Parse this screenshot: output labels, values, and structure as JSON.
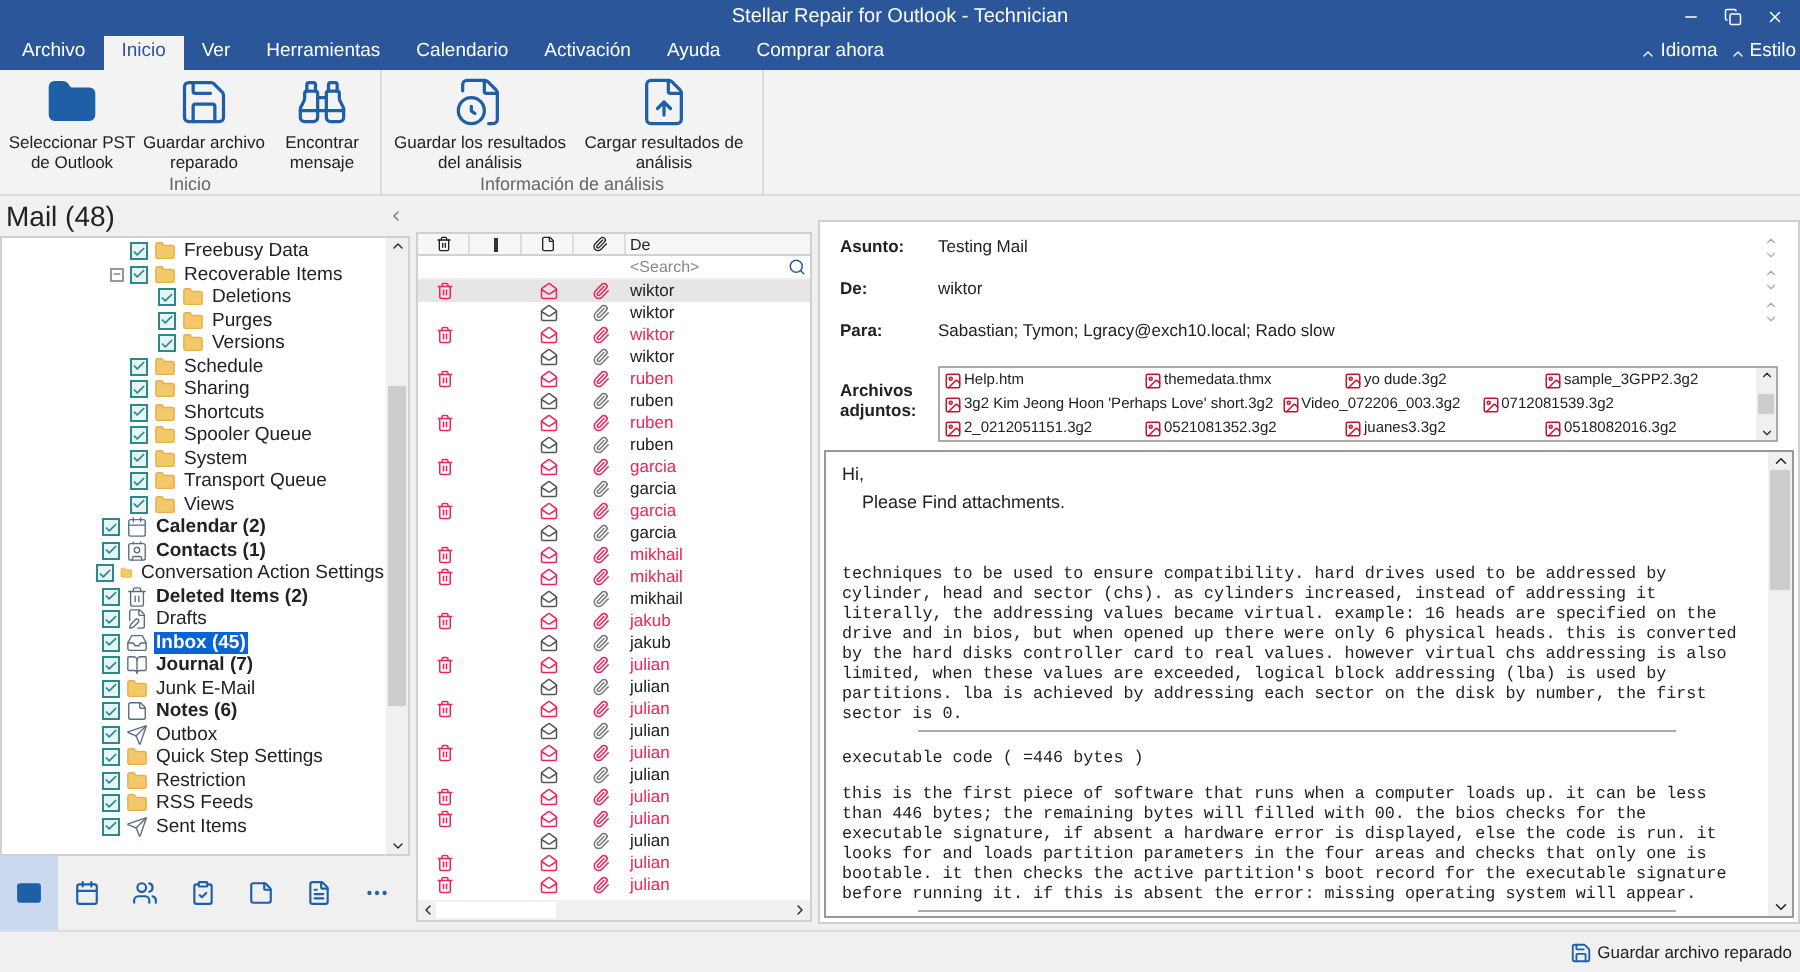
{
  "window": {
    "title": "Stellar Repair for Outlook - Technician"
  },
  "tabs": [
    {
      "label": "Archivo",
      "selected": false
    },
    {
      "label": "Inicio",
      "selected": true
    },
    {
      "label": "Ver",
      "selected": false
    },
    {
      "label": "Herramientas",
      "selected": false
    },
    {
      "label": "Calendario",
      "selected": false
    },
    {
      "label": "Activación",
      "selected": false
    },
    {
      "label": "Ayuda",
      "selected": false
    },
    {
      "label": "Comprar ahora",
      "selected": false
    }
  ],
  "menu_right": [
    "Idioma",
    "Estilo"
  ],
  "ribbon_groups": [
    {
      "label": "Inicio",
      "buttons": [
        {
          "kind": "folder",
          "label": "Seleccionar PST de Outlook"
        },
        {
          "kind": "save",
          "label": "Guardar archivo reparado"
        },
        {
          "kind": "find",
          "label": "Encontrar mensaje"
        }
      ]
    },
    {
      "label": "Información de análisis",
      "buttons": [
        {
          "kind": "save-scan",
          "label": "Guardar los resultados del análisis"
        },
        {
          "kind": "load-scan",
          "label": "Cargar resultados de análisis"
        }
      ]
    }
  ],
  "sidebar": {
    "title": "Mail (48)",
    "tree": [
      {
        "children": [
          {
            "label": "Freebusy Data",
            "kind": "folder",
            "checked": true,
            "unread": false,
            "selected": false
          },
          {
            "label": "Recoverable Items",
            "kind": "folder",
            "checked": true,
            "unread": false,
            "selected": false,
            "expanded": true,
            "children": [
              {
                "label": "Deletions",
                "kind": "folder",
                "checked": true,
                "unread": false,
                "selected": false
              },
              {
                "label": "Purges",
                "kind": "folder",
                "checked": true,
                "unread": false,
                "selected": false
              },
              {
                "label": "Versions",
                "kind": "folder",
                "checked": true,
                "unread": false,
                "selected": false
              }
            ]
          },
          {
            "label": "Schedule",
            "kind": "folder",
            "checked": true,
            "unread": false,
            "selected": false
          },
          {
            "label": "Sharing",
            "kind": "folder",
            "checked": true,
            "unread": false,
            "selected": false
          },
          {
            "label": "Shortcuts",
            "kind": "folder",
            "checked": true,
            "unread": false,
            "selected": false
          },
          {
            "label": "Spooler Queue",
            "kind": "folder",
            "checked": true,
            "unread": false,
            "selected": false
          },
          {
            "label": "System",
            "kind": "folder",
            "checked": true,
            "unread": false,
            "selected": false
          },
          {
            "label": "Transport Queue",
            "kind": "folder",
            "checked": true,
            "unread": false,
            "selected": false
          },
          {
            "label": "Views",
            "kind": "folder",
            "checked": true,
            "unread": false,
            "selected": false
          }
        ]
      },
      {
        "label": "Calendar (2)",
        "kind": "calendar",
        "checked": true,
        "unread": true,
        "selected": false
      },
      {
        "label": "Contacts (1)",
        "kind": "contacts",
        "checked": true,
        "unread": true,
        "selected": false
      },
      {
        "label": "Conversation Action Settings",
        "kind": "folder",
        "checked": true,
        "unread": false,
        "selected": false
      },
      {
        "label": "Deleted Items (2)",
        "kind": "trash",
        "checked": true,
        "unread": true,
        "selected": false
      },
      {
        "label": "Drafts",
        "kind": "drafts",
        "checked": true,
        "unread": false,
        "selected": false
      },
      {
        "label": "Inbox (45)",
        "kind": "inbox",
        "checked": true,
        "unread": true,
        "selected": true
      },
      {
        "label": "Journal (7)",
        "kind": "journal",
        "checked": true,
        "unread": true,
        "selected": false
      },
      {
        "label": "Junk E-Mail",
        "kind": "folder",
        "checked": true,
        "unread": false,
        "selected": false
      },
      {
        "label": "Notes (6)",
        "kind": "notes",
        "checked": true,
        "unread": true,
        "selected": false
      },
      {
        "label": "Outbox",
        "kind": "outbox",
        "checked": true,
        "unread": false,
        "selected": false
      },
      {
        "label": "Quick Step Settings",
        "kind": "folder",
        "checked": true,
        "unread": false,
        "selected": false
      },
      {
        "label": "Restriction",
        "kind": "folder",
        "checked": true,
        "unread": false,
        "selected": false
      },
      {
        "label": "RSS Feeds",
        "kind": "folder",
        "checked": true,
        "unread": false,
        "selected": false
      },
      {
        "label": "Sent Items",
        "kind": "sent",
        "checked": true,
        "unread": false,
        "selected": false
      }
    ]
  },
  "nav": [
    {
      "kind": "mail",
      "selected": true
    },
    {
      "kind": "calendar",
      "selected": false
    },
    {
      "kind": "contacts",
      "selected": false
    },
    {
      "kind": "tasks",
      "selected": false
    },
    {
      "kind": "notes",
      "selected": false
    },
    {
      "kind": "journal",
      "selected": false
    },
    {
      "kind": "more",
      "selected": false
    }
  ],
  "message_list": {
    "from_header": "De",
    "search_placeholder": "<Search>",
    "rows": [
      {
        "from": "wiktor",
        "deleted": true,
        "selected": true
      },
      {
        "from": "wiktor",
        "deleted": false,
        "selected": false
      },
      {
        "from": "wiktor",
        "deleted": true,
        "selected": false
      },
      {
        "from": "wiktor",
        "deleted": false,
        "selected": false
      },
      {
        "from": "ruben",
        "deleted": true,
        "selected": false
      },
      {
        "from": "ruben",
        "deleted": false,
        "selected": false
      },
      {
        "from": "ruben",
        "deleted": true,
        "selected": false
      },
      {
        "from": "ruben",
        "deleted": false,
        "selected": false
      },
      {
        "from": "garcia",
        "deleted": true,
        "selected": false
      },
      {
        "from": "garcia",
        "deleted": false,
        "selected": false
      },
      {
        "from": "garcia",
        "deleted": true,
        "selected": false
      },
      {
        "from": "garcia",
        "deleted": false,
        "selected": false
      },
      {
        "from": "mikhail",
        "deleted": true,
        "selected": false
      },
      {
        "from": "mikhail",
        "deleted": true,
        "selected": false
      },
      {
        "from": "mikhail",
        "deleted": false,
        "selected": false
      },
      {
        "from": "jakub",
        "deleted": true,
        "selected": false
      },
      {
        "from": "jakub",
        "deleted": false,
        "selected": false
      },
      {
        "from": "julian",
        "deleted": true,
        "selected": false
      },
      {
        "from": "julian",
        "deleted": false,
        "selected": false
      },
      {
        "from": "julian",
        "deleted": true,
        "selected": false
      },
      {
        "from": "julian",
        "deleted": false,
        "selected": false
      },
      {
        "from": "julian",
        "deleted": true,
        "selected": false
      },
      {
        "from": "julian",
        "deleted": false,
        "selected": false
      },
      {
        "from": "julian",
        "deleted": true,
        "selected": false
      },
      {
        "from": "julian",
        "deleted": true,
        "selected": false
      },
      {
        "from": "julian",
        "deleted": false,
        "selected": false
      },
      {
        "from": "julian",
        "deleted": true,
        "selected": false
      },
      {
        "from": "julian",
        "deleted": true,
        "selected": false
      }
    ]
  },
  "message": {
    "fields": [
      {
        "label": "Asunto:",
        "value": "Testing Mail"
      },
      {
        "label": "De:",
        "value": "wiktor"
      },
      {
        "label": "Para:",
        "value": "Sabastian; Tymon; Lgracy@exch10.local; Rado slow"
      }
    ],
    "attachments_label": "Archivos adjuntos:",
    "attachment_rows": [
      [
        "Help.htm",
        "themedata.thmx",
        "yo dude.3g2",
        "sample_3GPP2.3g2"
      ],
      [
        "3g2 Kim Jeong Hoon 'Perhaps Love' short.3g2",
        "Video_072206_003.3g2",
        "0712081539.3g2"
      ],
      [
        "2_0212051151.3g2",
        "0521081352.3g2",
        "juanes3.3g2",
        "0518082016.3g2"
      ]
    ],
    "greeting": "Hi,",
    "intro": "Please Find attachments.",
    "body": [
      {
        "kind": "text",
        "text": "techniques to be used to ensure compatibility. hard drives used to be addressed by cylinder, head and sector (chs). as cylinders increased, instead of addressing it literally, the addressing values became virtual. example: 16 heads are specified on the drive and in bios, but when opened up there were only 6 physical heads. this is converted by the hard disks controller card to real values. however virtual chs addressing is also limited, when these values are exceeded, logical block addressing (lba) is used by partitions. lba is achieved by addressing each sector on the disk by number, the first sector is 0."
      },
      {
        "kind": "rule"
      },
      {
        "kind": "text",
        "text": "executable code ( =446 bytes )"
      },
      {
        "kind": "text",
        "text": "this is the first piece of software that runs when a computer loads up. it can be less than 446 bytes; the remaining bytes will filled with 00. the bios checks for the executable signature, if absent a hardware error is displayed, else the code is run. it looks for and loads partition parameters in the four areas and checks that only one is bootable. it then checks the active partition's boot record for the executable signature before running it. if this is absent the error: missing operating system will appear."
      },
      {
        "kind": "rule"
      }
    ]
  },
  "status_bar": {
    "button": "Guardar archivo reparado"
  }
}
